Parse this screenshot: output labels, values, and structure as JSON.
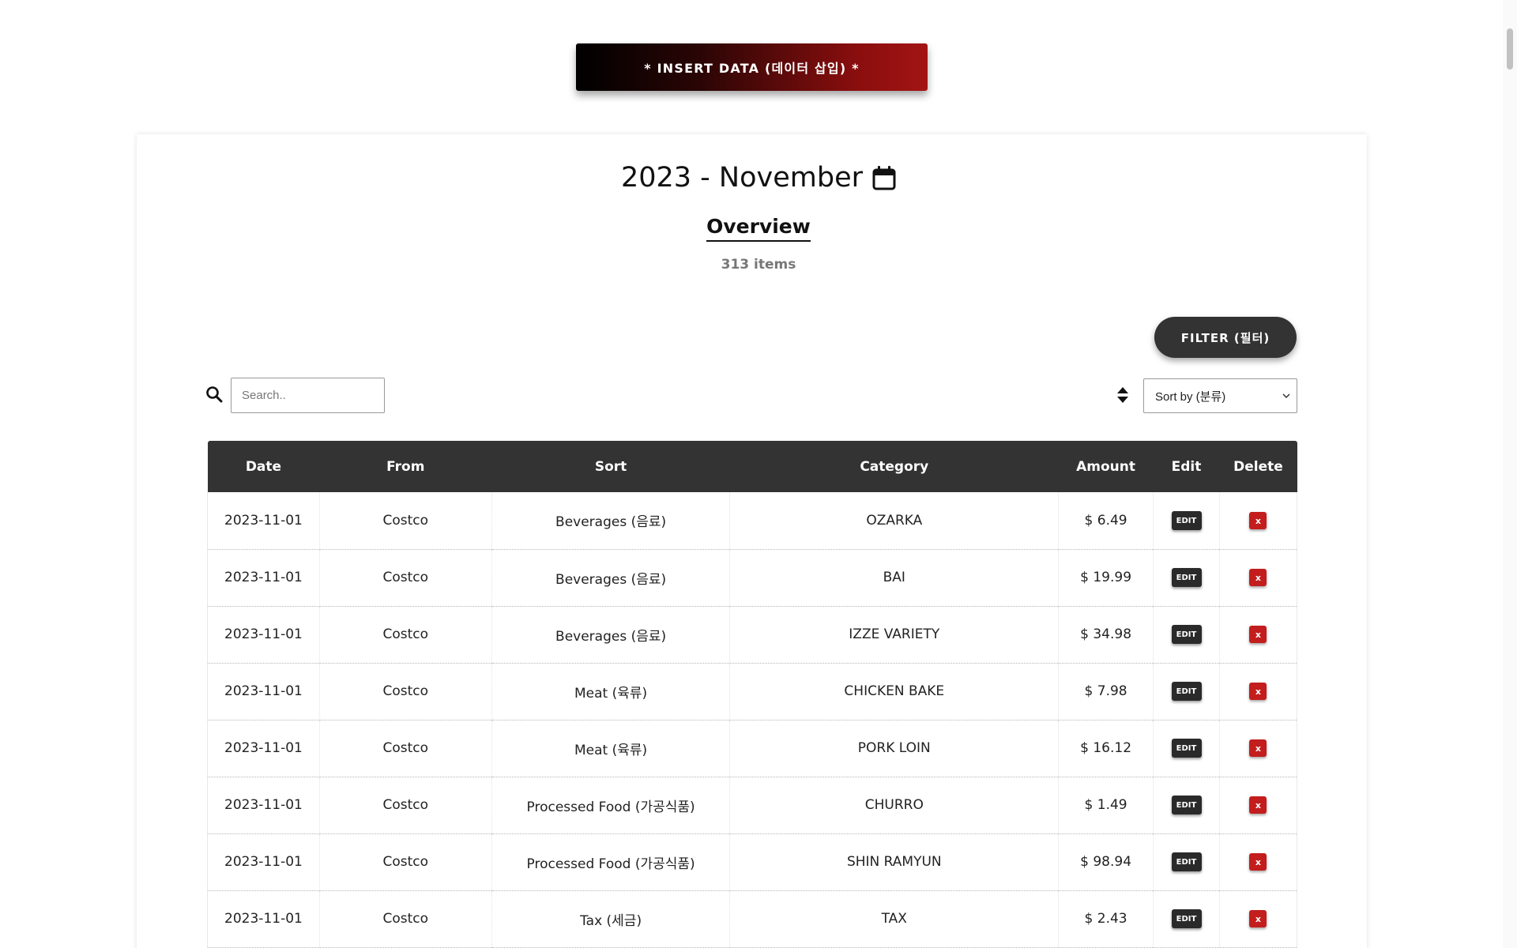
{
  "insert_button": {
    "label": "* INSERT DATA (데이터 삽입) *"
  },
  "header": {
    "month_title": "2023 - November",
    "overview_label": "Overview",
    "items_count": "313 items"
  },
  "filter_button": {
    "label": "FILTER (필터)"
  },
  "search": {
    "placeholder": "Search..",
    "value": ""
  },
  "sort_select": {
    "selected": "Sort by (분류)"
  },
  "table": {
    "columns": [
      "Date",
      "From",
      "Sort",
      "Category",
      "Amount",
      "Edit",
      "Delete"
    ],
    "edit_label": "EDIT",
    "delete_label": "x",
    "rows": [
      {
        "date": "2023-11-01",
        "from": "Costco",
        "sort": "Beverages (음료)",
        "category": "OZARKA",
        "amount": "$ 6.49"
      },
      {
        "date": "2023-11-01",
        "from": "Costco",
        "sort": "Beverages (음료)",
        "category": "BAI",
        "amount": "$ 19.99"
      },
      {
        "date": "2023-11-01",
        "from": "Costco",
        "sort": "Beverages (음료)",
        "category": "IZZE VARIETY",
        "amount": "$ 34.98"
      },
      {
        "date": "2023-11-01",
        "from": "Costco",
        "sort": "Meat (육류)",
        "category": "CHICKEN BAKE",
        "amount": "$ 7.98"
      },
      {
        "date": "2023-11-01",
        "from": "Costco",
        "sort": "Meat (육류)",
        "category": "PORK LOIN",
        "amount": "$ 16.12"
      },
      {
        "date": "2023-11-01",
        "from": "Costco",
        "sort": "Processed Food (가공식품)",
        "category": "CHURRO",
        "amount": "$ 1.49"
      },
      {
        "date": "2023-11-01",
        "from": "Costco",
        "sort": "Processed Food (가공식품)",
        "category": "SHIN RAMYUN",
        "amount": "$ 98.94"
      },
      {
        "date": "2023-11-01",
        "from": "Costco",
        "sort": "Tax (세금)",
        "category": "TAX",
        "amount": "$ 2.43"
      }
    ]
  },
  "icons": {
    "calendar": "calendar-icon",
    "search": "search-icon",
    "sort": "sort-icon",
    "chevron": "chevron-down-icon"
  },
  "colors": {
    "header_bg": "#333333",
    "delete_red": "#c31d1d",
    "insert_gradient_end": "#a31414"
  }
}
